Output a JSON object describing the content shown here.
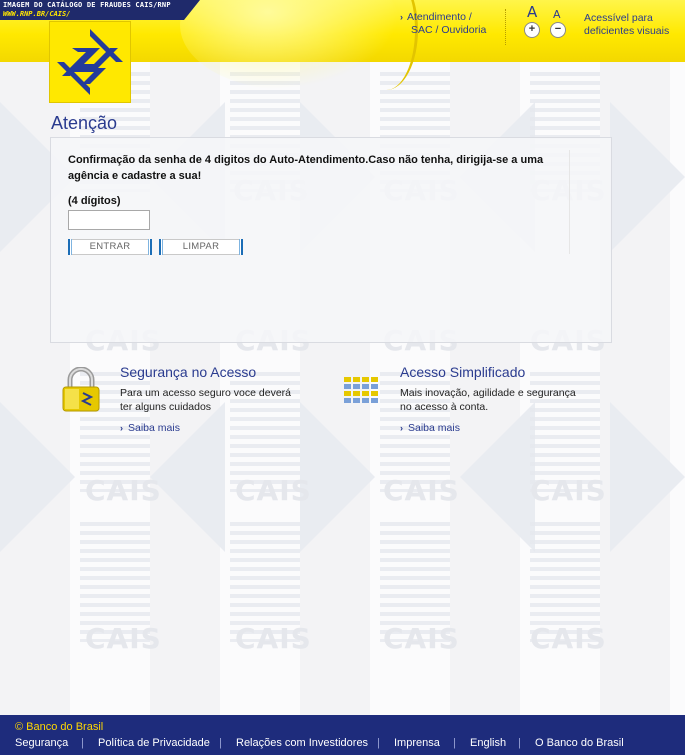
{
  "watermark": {
    "catalog_line1": "IMAGEM DO CATÁLOGO DE FRAUDES CAIS/RNP",
    "catalog_line2": "WWW.RNP.BR/CAIS/",
    "stamp": "CAIS"
  },
  "header": {
    "atendimento_label": "Atendimento /",
    "ouvidoria_label": "SAC / Ouvidoria",
    "font_large_glyph": "A",
    "font_small_glyph": "A",
    "font_increase": "+",
    "font_decrease": "−",
    "accessible_label": "Acessível para deficientes visuais"
  },
  "main": {
    "title": "Atenção",
    "message": "Confirmação da senha de 4 digitos do Auto-Atendimento.Caso não tenha, dirigija-se a uma agência e cadastre a sua!",
    "pin_label": "(4 dígitos)",
    "pin_value": "",
    "enter_button": "ENTRAR",
    "clear_button": "LIMPAR"
  },
  "sections": [
    {
      "title": "Segurança no Acesso",
      "text": "Para um acesso seguro voce deverá ter alguns cuidados",
      "link": "Saiba mais",
      "icon": "padlock-icon"
    },
    {
      "title": "Acesso Simplificado",
      "text": "Mais inovação, agilidade e segurança no acesso à conta.",
      "link": "Saiba mais",
      "icon": "keypad-icon"
    }
  ],
  "footer": {
    "copyright": "© Banco do Brasil",
    "links": [
      "Segurança",
      "Política de Privacidade",
      "Relações com Investidores",
      "Imprensa",
      "English",
      "O Banco do Brasil"
    ]
  },
  "colors": {
    "brand_yellow": "#ffe900",
    "brand_blue": "#2a3b8f",
    "footer_blue": "#1e2c7c",
    "footer_copyright": "#ffd800"
  }
}
